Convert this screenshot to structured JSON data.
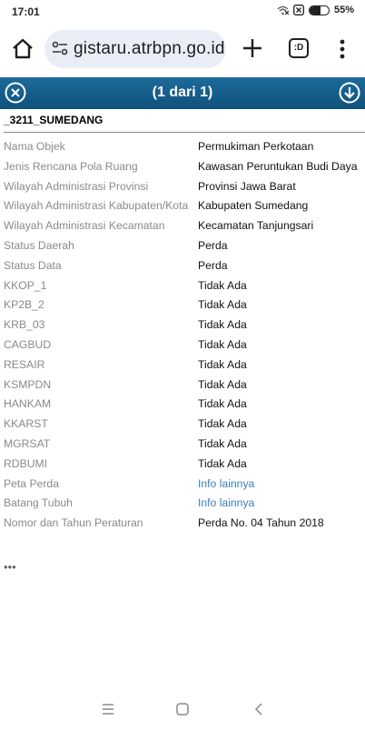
{
  "status_bar": {
    "time": "17:01",
    "battery": "55%",
    "battery_level": 0.55
  },
  "browser": {
    "url": "gistaru.atrbpn.go.id",
    "tabs_label": ":D"
  },
  "popup": {
    "title": "(1 dari 1)",
    "feature_name": "_3211_SUMEDANG",
    "attributes": [
      {
        "key": "Nama Objek",
        "value": "Permukiman Perkotaan",
        "link": false
      },
      {
        "key": "Jenis Rencana Pola Ruang",
        "value": "Kawasan Peruntukan Budi Daya",
        "link": false
      },
      {
        "key": "Wilayah Administrasi Provinsi",
        "value": "Provinsi Jawa Barat",
        "link": false
      },
      {
        "key": "Wilayah Administrasi Kabupaten/Kota",
        "value": "Kabupaten Sumedang",
        "link": false
      },
      {
        "key": "Wilayah Administrasi Kecamatan",
        "value": "Kecamatan Tanjungsari",
        "link": false
      },
      {
        "key": "Status Daerah",
        "value": "Perda",
        "link": false
      },
      {
        "key": "Status Data",
        "value": "Perda",
        "link": false
      },
      {
        "key": "KKOP_1",
        "value": "Tidak Ada",
        "link": false
      },
      {
        "key": "KP2B_2",
        "value": "Tidak Ada",
        "link": false
      },
      {
        "key": "KRB_03",
        "value": "Tidak Ada",
        "link": false
      },
      {
        "key": "CAGBUD",
        "value": "Tidak Ada",
        "link": false
      },
      {
        "key": "RESAIR",
        "value": "Tidak Ada",
        "link": false
      },
      {
        "key": "KSMPDN",
        "value": "Tidak Ada",
        "link": false
      },
      {
        "key": "HANKAM",
        "value": "Tidak Ada",
        "link": false
      },
      {
        "key": "KKARST",
        "value": "Tidak Ada",
        "link": false
      },
      {
        "key": "MGRSAT",
        "value": "Tidak Ada",
        "link": false
      },
      {
        "key": "RDBUMI",
        "value": "Tidak Ada",
        "link": false
      },
      {
        "key": "Peta Perda",
        "value": "Info lainnya",
        "link": true
      },
      {
        "key": "Batang Tubuh",
        "value": "Info lainnya",
        "link": true
      },
      {
        "key": "Nomor dan Tahun Peraturan",
        "value": "Perda No. 04 Tahun 2018",
        "link": false
      }
    ],
    "more": "•••"
  },
  "colors": {
    "header_bg": "#10527c",
    "link": "#3a7fb8",
    "url_bg": "#e9eef6"
  }
}
